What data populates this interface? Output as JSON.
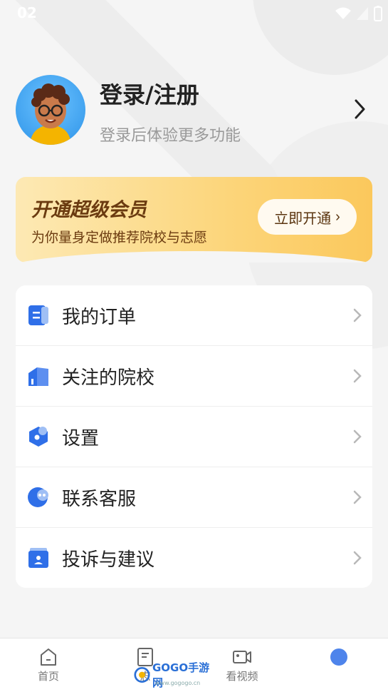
{
  "status_bar": {
    "time": "02"
  },
  "profile": {
    "title": "登录/注册",
    "subtitle": "登录后体验更多功能"
  },
  "vip": {
    "title": "开通超级会员",
    "subtitle": "为你量身定做推荐院校与志愿",
    "button_label": "立即开通",
    "button_chevron": "›"
  },
  "menu": [
    {
      "label": "我的订单",
      "icon": "order-icon"
    },
    {
      "label": "关注的院校",
      "icon": "school-icon"
    },
    {
      "label": "设置",
      "icon": "settings-icon"
    },
    {
      "label": "联系客服",
      "icon": "customer-service-icon"
    },
    {
      "label": "投诉与建议",
      "icon": "feedback-icon"
    }
  ],
  "tabbar": [
    {
      "label": "首页",
      "icon": "home-icon"
    },
    {
      "label": "志",
      "icon": "volunteer-icon"
    },
    {
      "label": "看视频",
      "icon": "video-icon"
    },
    {
      "label": "",
      "icon": "me-icon"
    }
  ],
  "watermark": {
    "text": "GOGO手游网",
    "sub": "www.gogogo.cn"
  },
  "colors": {
    "accent_blue": "#2f6fe8",
    "vip_text": "#6b3b10",
    "vip_gradient_start": "#fde9b4",
    "vip_gradient_end": "#fbc85c"
  }
}
